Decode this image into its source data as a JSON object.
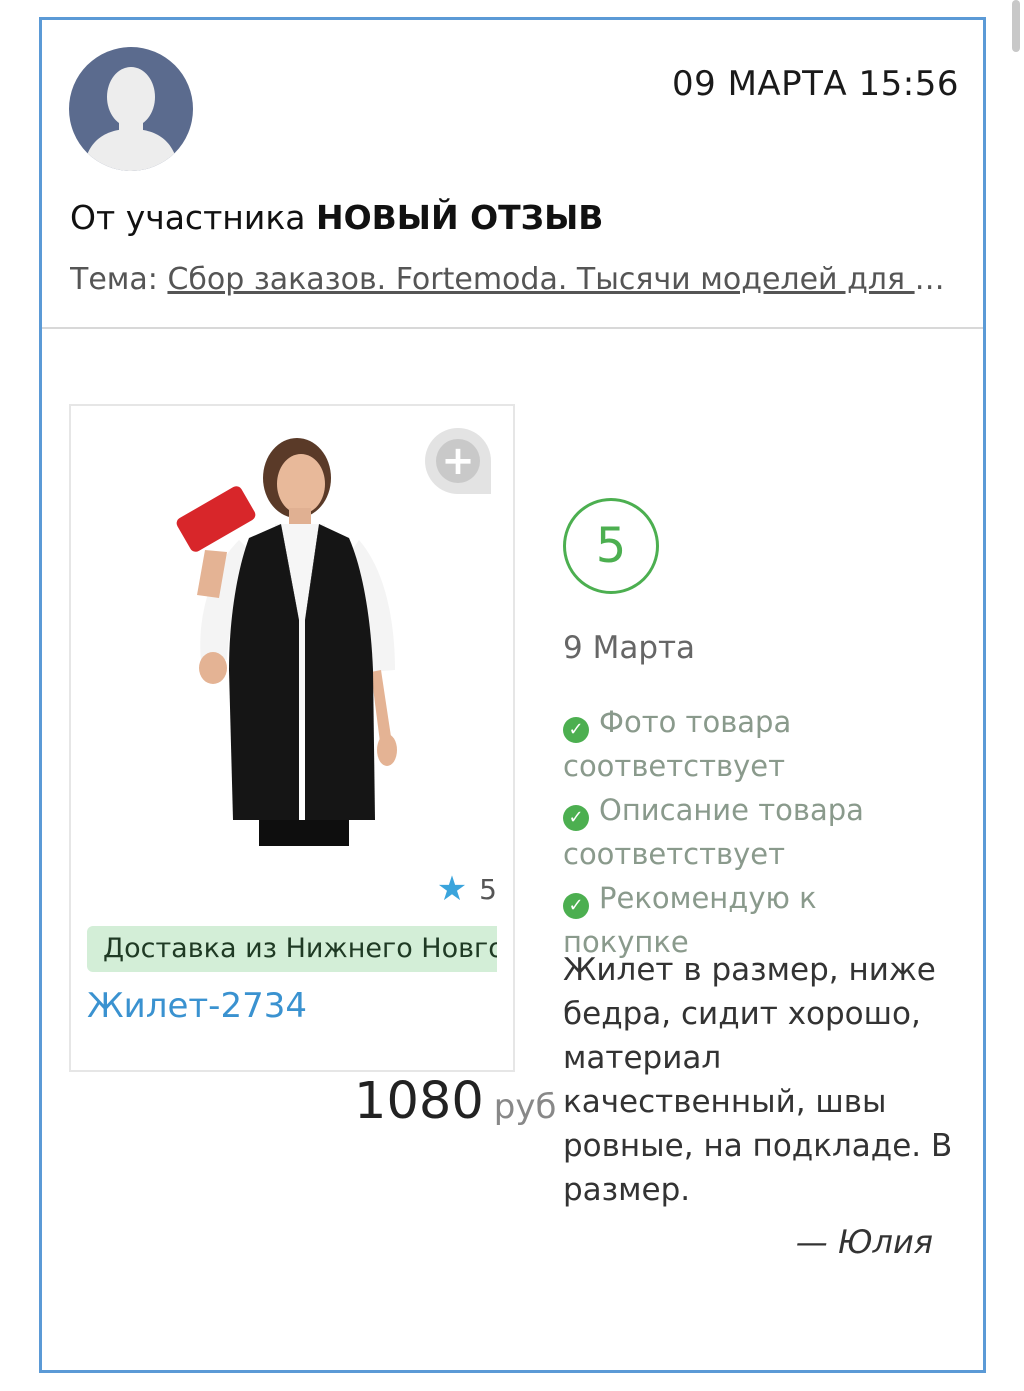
{
  "header": {
    "datetime": "09 МАРТА 15:56",
    "from_prefix": "От участника",
    "from_name": "НОВЫЙ ОТЗЫВ",
    "topic_label": "Тема:",
    "topic_link": "Сбор заказов. Fortemoda. Тысячи моделей для ш..."
  },
  "product": {
    "rating": "5",
    "delivery": "Доставка из Нижнего Новгорода",
    "name": "Жилет-2734",
    "price": "1080",
    "currency": "руб"
  },
  "review": {
    "score": "5",
    "date": "9 Марта",
    "checks": [
      "Фото товара соответствует",
      "Описание товара соответствует",
      "Рекомендую к покупке"
    ],
    "text": "Жилет в размер, ниже бедра, сидит хорошо, материал качественный, швы ровные, на подкладе. В размер.",
    "author": "— Юлия"
  },
  "colors": {
    "border": "#5b9ad6",
    "accent_green": "#4caf50",
    "link_blue": "#3a92d0",
    "delivery_bg": "#d3eed7"
  },
  "icons": [
    "user-avatar-icon",
    "add-plus-icon",
    "star-icon",
    "check-circle-icon"
  ]
}
